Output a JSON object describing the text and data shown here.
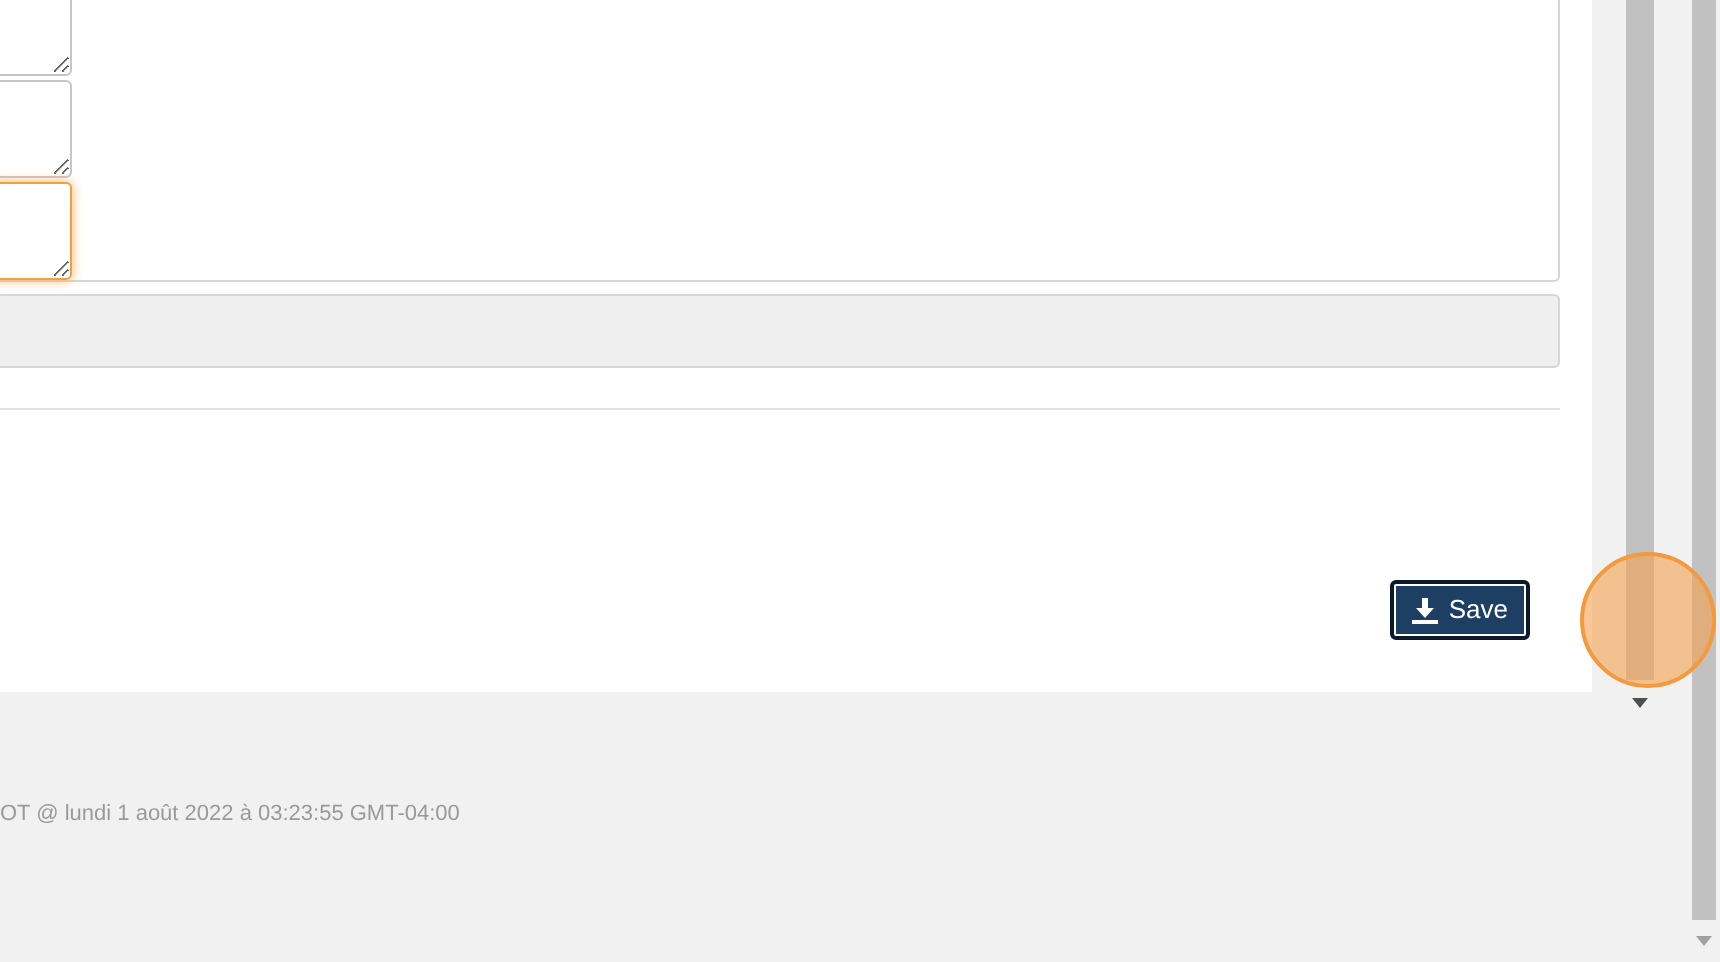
{
  "form": {
    "textareas": [
      {
        "focused": false
      },
      {
        "focused": false
      },
      {
        "focused": true
      }
    ]
  },
  "save_button": {
    "label": "Save"
  },
  "footer": {
    "text": "OT @ lundi 1 août 2022 à 03:23:55 GMT-04:00"
  }
}
